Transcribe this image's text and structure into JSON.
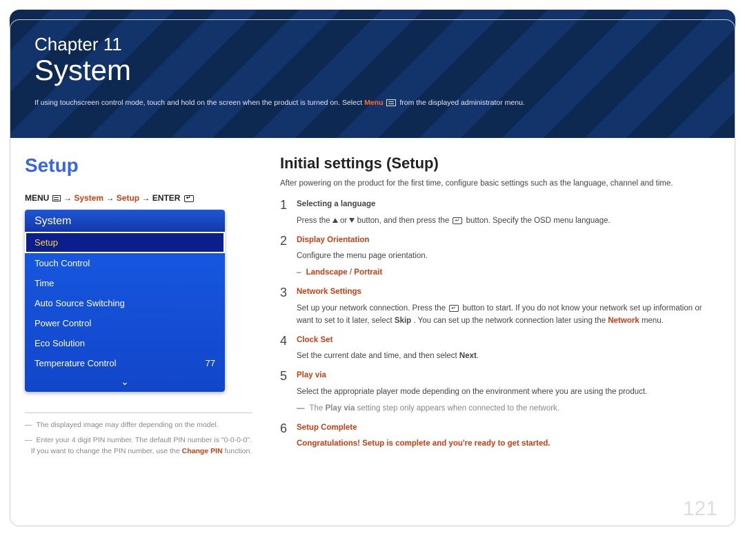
{
  "banner": {
    "chapter_label": "Chapter 11",
    "chapter_title": "System",
    "intro_pre": "If using touchscreen control mode, touch and hold on the screen when the product is turned on. Select ",
    "intro_menu_word": "Menu",
    "intro_post": " from the displayed administrator menu."
  },
  "left": {
    "setup_heading": "Setup",
    "breadcrumb": {
      "menu": "MENU",
      "arrow": "→",
      "system": "System",
      "setup": "Setup",
      "enter": "ENTER"
    },
    "osd": {
      "title": "System",
      "items": [
        {
          "label": "Setup",
          "value": "",
          "selected": true
        },
        {
          "label": "Touch Control",
          "value": ""
        },
        {
          "label": "Time",
          "value": ""
        },
        {
          "label": "Auto Source Switching",
          "value": ""
        },
        {
          "label": "Power Control",
          "value": ""
        },
        {
          "label": "Eco Solution",
          "value": ""
        },
        {
          "label": "Temperature Control",
          "value": "77"
        }
      ],
      "down_indicator": "⌄"
    },
    "footnotes": {
      "f1": "The displayed image may differ depending on the model.",
      "f2a": "Enter your 4 digit PIN number. The default PIN number is \"0-0-0-0\".",
      "f2b_pre": "If you want to change the PIN number, use the ",
      "f2b_hl": "Change PIN",
      "f2b_post": " function."
    }
  },
  "right": {
    "heading": "Initial settings (Setup)",
    "intro": "After powering on the product for the first time, configure basic settings such as the language, channel and time.",
    "steps": [
      {
        "num": "1",
        "title_plain": "Selecting a language",
        "body_parts": [
          "Press the ",
          "TRI_UP",
          " or ",
          "TRI_DOWN",
          " button, and then press the ",
          "ENTER",
          " button. Specify the OSD menu language."
        ]
      },
      {
        "num": "2",
        "title_red": "Display Orientation",
        "body_plain": "Configure the menu page orientation.",
        "sub_red_parts": [
          "Landscape",
          " / ",
          "Portrait"
        ]
      },
      {
        "num": "3",
        "title_red": "Network Settings",
        "body_net_pre": "Set up your network connection. Press the ",
        "body_net_mid": " button to start. If you do not know your network set up information or want to set to it later, select ",
        "body_net_skip": "Skip",
        "body_net_mid2": ". You can set up the network connection later using the ",
        "body_net_network": "Network",
        "body_net_post": " menu."
      },
      {
        "num": "4",
        "title_red": "Clock Set",
        "body_clock_pre": "Set the current date and time, and then select ",
        "body_clock_next": "Next",
        "body_clock_post": "."
      },
      {
        "num": "5",
        "title_red": "Play via",
        "body_plain": "Select the appropriate player mode depending on the environment where you are using the product.",
        "sub_note_pre": "The ",
        "sub_note_hl": "Play via",
        "sub_note_post": " setting step only appears when connected to the network."
      },
      {
        "num": "6",
        "title_red": "Setup Complete",
        "body_red_bold": "Congratulations! Setup is complete and you're ready to get started."
      }
    ]
  },
  "page_number": "121"
}
